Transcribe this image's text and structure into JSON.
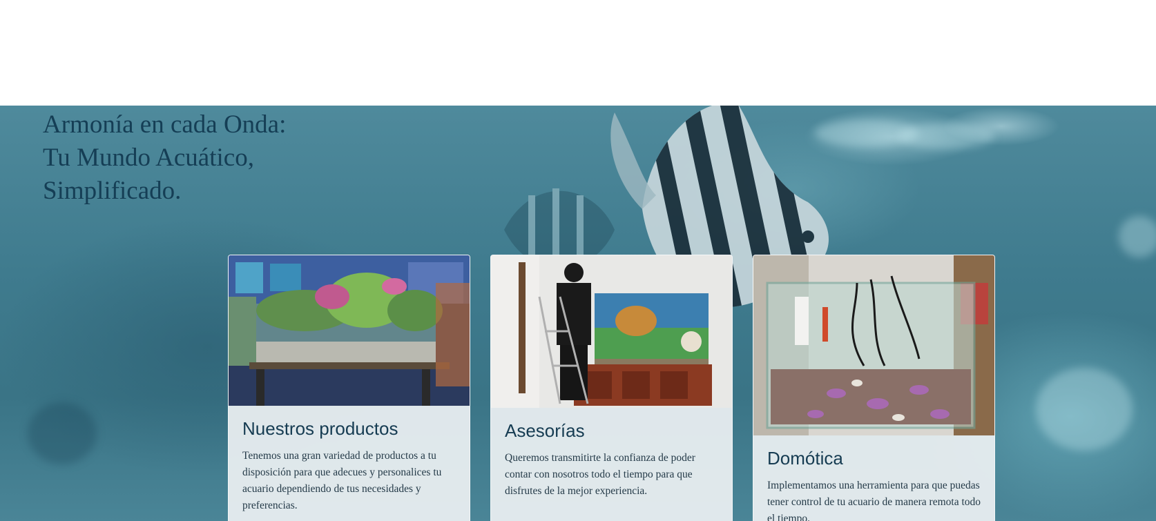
{
  "hero": {
    "title_lines": [
      "Armonía en cada Onda:",
      "Tu Mundo Acuático,",
      "Simplificado."
    ]
  },
  "cards": [
    {
      "title": "Nuestros productos",
      "text": "Tenemos una gran variedad de productos a tu disposición para que adecues y personalices tu acuario dependiendo de tus necesidades y preferencias.",
      "image": "planted-aquarium-photo"
    },
    {
      "title": "Asesorías",
      "text": "Queremos transmitirte la confianza de poder contar con nosotros todo el tiempo para que disfrutes de la mejor experiencia.",
      "image": "aquarium-maintenance-photo"
    },
    {
      "title": "Domótica",
      "text": "Implementamos una herramienta para que puedas tener control de tu acuario de manera remota todo el tiempo.",
      "image": "aquarium-automation-photo"
    }
  ],
  "colors": {
    "title_text": "#153e55",
    "card_background": "#eceff1",
    "hero_base": "#3f7b8e"
  }
}
